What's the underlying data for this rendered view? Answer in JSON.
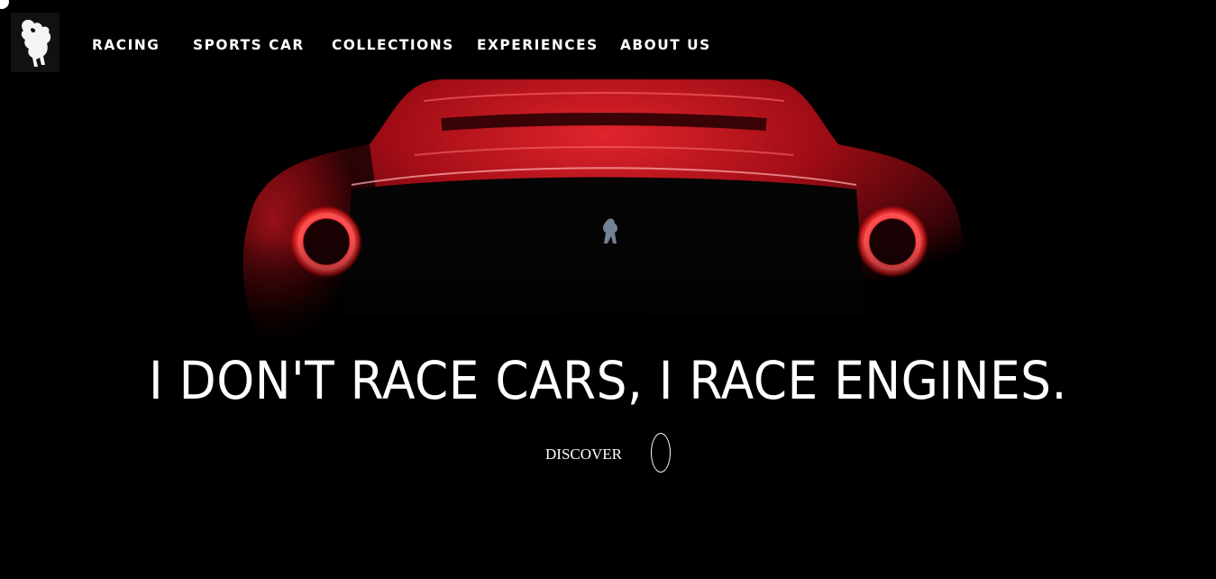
{
  "nav": {
    "items": [
      {
        "label": "RACING"
      },
      {
        "label": "SPORTS CAR"
      },
      {
        "label": "COLLECTIONS"
      },
      {
        "label": "EXPERIENCES"
      },
      {
        "label": "ABOUT US"
      }
    ]
  },
  "hero": {
    "headline": "I DON'T RACE CARS, I RACE ENGINES.",
    "discover_label": "DISCOVER"
  },
  "icons": {
    "logo": "prancing-horse-logo",
    "discover": "scroll-oval-icon"
  },
  "colors": {
    "background": "#000000",
    "car_red": "#c4121d",
    "text": "#ffffff"
  }
}
